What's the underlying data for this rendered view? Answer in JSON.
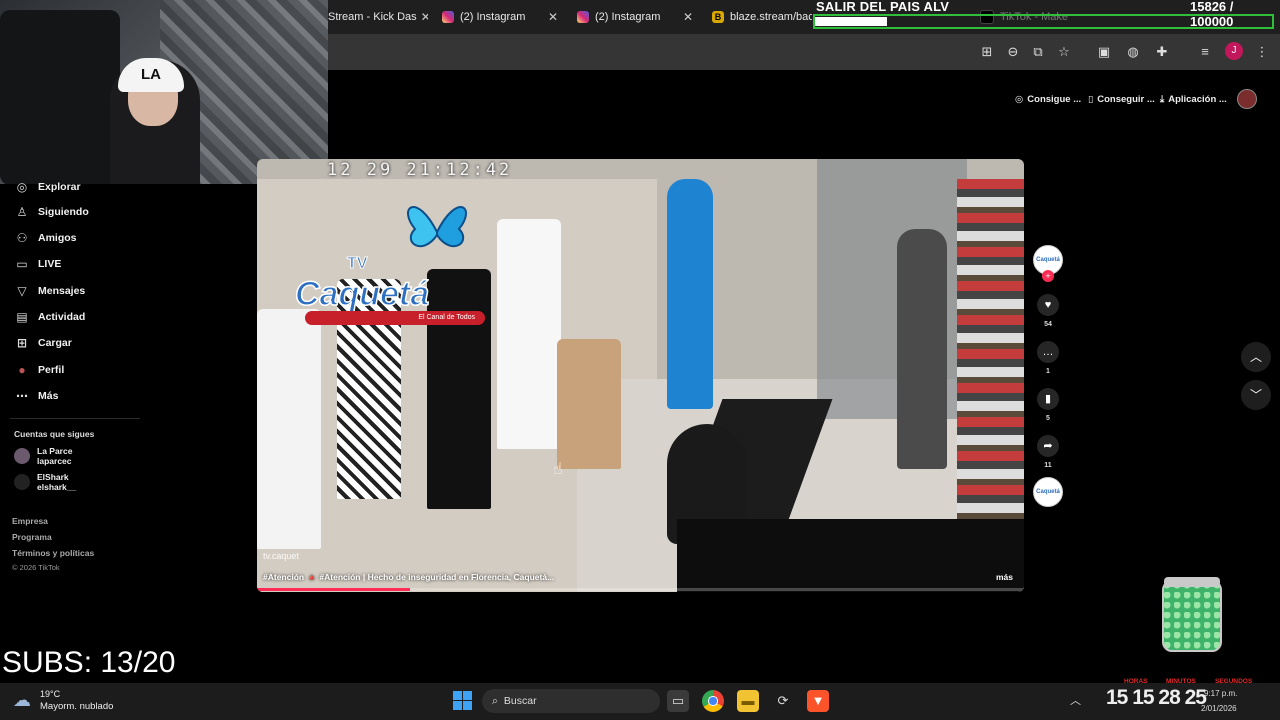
{
  "browser": {
    "tabs": [
      {
        "label": "Stream - Kick Das",
        "icon": "kick-icon"
      },
      {
        "label": "(2) Instagram",
        "icon": "instagram-icon"
      },
      {
        "label": "(2) Instagram",
        "icon": "instagram-icon"
      },
      {
        "label": "blaze.stream/back",
        "icon": "blaze-icon"
      },
      {
        "label": "TikTok - Make",
        "icon": "tiktok-icon"
      }
    ],
    "profile_initial": "J"
  },
  "overlay": {
    "goal_title": "SALIR DEL PAIS ALV",
    "goal_count": "15826 / 100000",
    "goal_progress": 0.158,
    "subs": "SUBS: 13/20"
  },
  "tiktok": {
    "header_buttons": [
      {
        "label": "Consigue ...",
        "icon": "coin-icon"
      },
      {
        "label": "Conseguir ...",
        "icon": "phone-icon"
      },
      {
        "label": "Aplicación ...",
        "icon": "download-icon"
      }
    ],
    "nav": [
      {
        "label": "Explorar",
        "icon": "compass-icon"
      },
      {
        "label": "Siguiendo",
        "icon": "following-icon"
      },
      {
        "label": "Amigos",
        "icon": "friends-icon"
      },
      {
        "label": "LIVE",
        "icon": "live-icon"
      },
      {
        "label": "Mensajes",
        "icon": "messages-icon"
      },
      {
        "label": "Actividad",
        "icon": "activity-icon"
      },
      {
        "label": "Cargar",
        "icon": "upload-icon"
      },
      {
        "label": "Perfil",
        "icon": "profile-icon"
      },
      {
        "label": "Más",
        "icon": "more-icon"
      }
    ],
    "following_title": "Cuentas que sigues",
    "following": [
      {
        "name": "La Parce",
        "handle": "laparcec"
      },
      {
        "name": "ElShark",
        "handle": "elshark__"
      }
    ],
    "footer": [
      "Empresa",
      "Programa",
      "Términos y políticas"
    ],
    "copyright": "© 2026 TikTok",
    "video": {
      "timestamp": "12 29 21:12:42",
      "brand_tv": "TV",
      "brand_name": "Caquetá",
      "brand_tagline": "El Canal de Todos",
      "watermark": "tv.caquet",
      "caption": "#Atención 🔺 #Atención | Hecho de inseguridad en Florencia, Caquetá...",
      "more": "más",
      "progress": 0.2
    },
    "actions": {
      "likes": "54",
      "comments": "1",
      "saves": "5",
      "shares": "11"
    },
    "creator_label": "Caquetá"
  },
  "taskbar": {
    "weather_temp": "19°C",
    "weather_desc": "Mayorm. nublado",
    "search_placeholder": "Buscar",
    "clock_digits": "15 15  28  25",
    "labels": [
      "HORAS",
      "MINUTOS",
      "SEGUNDOS"
    ],
    "time": "9:17 p.m.",
    "date": "2/01/2026"
  }
}
